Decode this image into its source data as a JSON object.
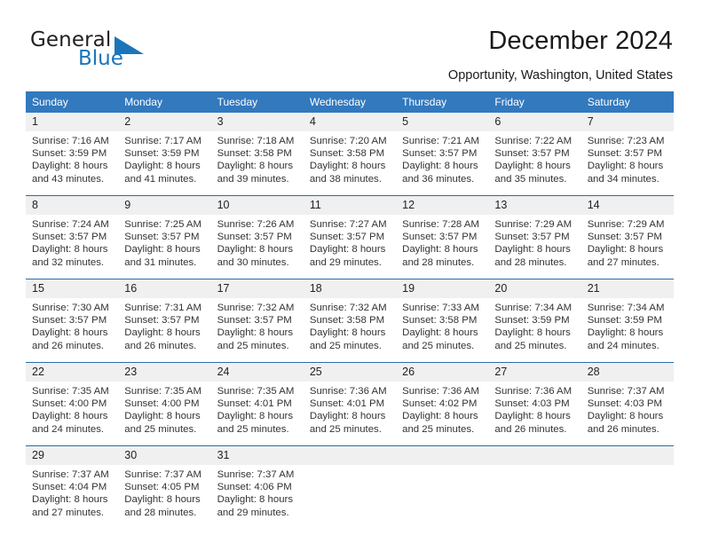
{
  "brand": {
    "word_one": "General",
    "word_two": "Blue",
    "triangle_color": "#1b75bb",
    "text_color": "#231f20"
  },
  "header": {
    "title": "December 2024",
    "location": "Opportunity, Washington, United States"
  },
  "theme": {
    "header_blue": "#3279be",
    "row_divider_blue": "#2b6ca8",
    "daynum_background": "#f0f0f0",
    "body_background": "#ffffff"
  },
  "weekdays": [
    "Sunday",
    "Monday",
    "Tuesday",
    "Wednesday",
    "Thursday",
    "Friday",
    "Saturday"
  ],
  "weeks": [
    [
      {
        "day": "1",
        "sunrise": "Sunrise: 7:16 AM",
        "sunset": "Sunset: 3:59 PM",
        "daylight_line1": "Daylight: 8 hours",
        "daylight_line2": "and 43 minutes."
      },
      {
        "day": "2",
        "sunrise": "Sunrise: 7:17 AM",
        "sunset": "Sunset: 3:59 PM",
        "daylight_line1": "Daylight: 8 hours",
        "daylight_line2": "and 41 minutes."
      },
      {
        "day": "3",
        "sunrise": "Sunrise: 7:18 AM",
        "sunset": "Sunset: 3:58 PM",
        "daylight_line1": "Daylight: 8 hours",
        "daylight_line2": "and 39 minutes."
      },
      {
        "day": "4",
        "sunrise": "Sunrise: 7:20 AM",
        "sunset": "Sunset: 3:58 PM",
        "daylight_line1": "Daylight: 8 hours",
        "daylight_line2": "and 38 minutes."
      },
      {
        "day": "5",
        "sunrise": "Sunrise: 7:21 AM",
        "sunset": "Sunset: 3:57 PM",
        "daylight_line1": "Daylight: 8 hours",
        "daylight_line2": "and 36 minutes."
      },
      {
        "day": "6",
        "sunrise": "Sunrise: 7:22 AM",
        "sunset": "Sunset: 3:57 PM",
        "daylight_line1": "Daylight: 8 hours",
        "daylight_line2": "and 35 minutes."
      },
      {
        "day": "7",
        "sunrise": "Sunrise: 7:23 AM",
        "sunset": "Sunset: 3:57 PM",
        "daylight_line1": "Daylight: 8 hours",
        "daylight_line2": "and 34 minutes."
      }
    ],
    [
      {
        "day": "8",
        "sunrise": "Sunrise: 7:24 AM",
        "sunset": "Sunset: 3:57 PM",
        "daylight_line1": "Daylight: 8 hours",
        "daylight_line2": "and 32 minutes."
      },
      {
        "day": "9",
        "sunrise": "Sunrise: 7:25 AM",
        "sunset": "Sunset: 3:57 PM",
        "daylight_line1": "Daylight: 8 hours",
        "daylight_line2": "and 31 minutes."
      },
      {
        "day": "10",
        "sunrise": "Sunrise: 7:26 AM",
        "sunset": "Sunset: 3:57 PM",
        "daylight_line1": "Daylight: 8 hours",
        "daylight_line2": "and 30 minutes."
      },
      {
        "day": "11",
        "sunrise": "Sunrise: 7:27 AM",
        "sunset": "Sunset: 3:57 PM",
        "daylight_line1": "Daylight: 8 hours",
        "daylight_line2": "and 29 minutes."
      },
      {
        "day": "12",
        "sunrise": "Sunrise: 7:28 AM",
        "sunset": "Sunset: 3:57 PM",
        "daylight_line1": "Daylight: 8 hours",
        "daylight_line2": "and 28 minutes."
      },
      {
        "day": "13",
        "sunrise": "Sunrise: 7:29 AM",
        "sunset": "Sunset: 3:57 PM",
        "daylight_line1": "Daylight: 8 hours",
        "daylight_line2": "and 28 minutes."
      },
      {
        "day": "14",
        "sunrise": "Sunrise: 7:29 AM",
        "sunset": "Sunset: 3:57 PM",
        "daylight_line1": "Daylight: 8 hours",
        "daylight_line2": "and 27 minutes."
      }
    ],
    [
      {
        "day": "15",
        "sunrise": "Sunrise: 7:30 AM",
        "sunset": "Sunset: 3:57 PM",
        "daylight_line1": "Daylight: 8 hours",
        "daylight_line2": "and 26 minutes."
      },
      {
        "day": "16",
        "sunrise": "Sunrise: 7:31 AM",
        "sunset": "Sunset: 3:57 PM",
        "daylight_line1": "Daylight: 8 hours",
        "daylight_line2": "and 26 minutes."
      },
      {
        "day": "17",
        "sunrise": "Sunrise: 7:32 AM",
        "sunset": "Sunset: 3:57 PM",
        "daylight_line1": "Daylight: 8 hours",
        "daylight_line2": "and 25 minutes."
      },
      {
        "day": "18",
        "sunrise": "Sunrise: 7:32 AM",
        "sunset": "Sunset: 3:58 PM",
        "daylight_line1": "Daylight: 8 hours",
        "daylight_line2": "and 25 minutes."
      },
      {
        "day": "19",
        "sunrise": "Sunrise: 7:33 AM",
        "sunset": "Sunset: 3:58 PM",
        "daylight_line1": "Daylight: 8 hours",
        "daylight_line2": "and 25 minutes."
      },
      {
        "day": "20",
        "sunrise": "Sunrise: 7:34 AM",
        "sunset": "Sunset: 3:59 PM",
        "daylight_line1": "Daylight: 8 hours",
        "daylight_line2": "and 25 minutes."
      },
      {
        "day": "21",
        "sunrise": "Sunrise: 7:34 AM",
        "sunset": "Sunset: 3:59 PM",
        "daylight_line1": "Daylight: 8 hours",
        "daylight_line2": "and 24 minutes."
      }
    ],
    [
      {
        "day": "22",
        "sunrise": "Sunrise: 7:35 AM",
        "sunset": "Sunset: 4:00 PM",
        "daylight_line1": "Daylight: 8 hours",
        "daylight_line2": "and 24 minutes."
      },
      {
        "day": "23",
        "sunrise": "Sunrise: 7:35 AM",
        "sunset": "Sunset: 4:00 PM",
        "daylight_line1": "Daylight: 8 hours",
        "daylight_line2": "and 25 minutes."
      },
      {
        "day": "24",
        "sunrise": "Sunrise: 7:35 AM",
        "sunset": "Sunset: 4:01 PM",
        "daylight_line1": "Daylight: 8 hours",
        "daylight_line2": "and 25 minutes."
      },
      {
        "day": "25",
        "sunrise": "Sunrise: 7:36 AM",
        "sunset": "Sunset: 4:01 PM",
        "daylight_line1": "Daylight: 8 hours",
        "daylight_line2": "and 25 minutes."
      },
      {
        "day": "26",
        "sunrise": "Sunrise: 7:36 AM",
        "sunset": "Sunset: 4:02 PM",
        "daylight_line1": "Daylight: 8 hours",
        "daylight_line2": "and 25 minutes."
      },
      {
        "day": "27",
        "sunrise": "Sunrise: 7:36 AM",
        "sunset": "Sunset: 4:03 PM",
        "daylight_line1": "Daylight: 8 hours",
        "daylight_line2": "and 26 minutes."
      },
      {
        "day": "28",
        "sunrise": "Sunrise: 7:37 AM",
        "sunset": "Sunset: 4:03 PM",
        "daylight_line1": "Daylight: 8 hours",
        "daylight_line2": "and 26 minutes."
      }
    ],
    [
      {
        "day": "29",
        "sunrise": "Sunrise: 7:37 AM",
        "sunset": "Sunset: 4:04 PM",
        "daylight_line1": "Daylight: 8 hours",
        "daylight_line2": "and 27 minutes."
      },
      {
        "day": "30",
        "sunrise": "Sunrise: 7:37 AM",
        "sunset": "Sunset: 4:05 PM",
        "daylight_line1": "Daylight: 8 hours",
        "daylight_line2": "and 28 minutes."
      },
      {
        "day": "31",
        "sunrise": "Sunrise: 7:37 AM",
        "sunset": "Sunset: 4:06 PM",
        "daylight_line1": "Daylight: 8 hours",
        "daylight_line2": "and 29 minutes."
      },
      {
        "day": "",
        "sunrise": "",
        "sunset": "",
        "daylight_line1": "",
        "daylight_line2": ""
      },
      {
        "day": "",
        "sunrise": "",
        "sunset": "",
        "daylight_line1": "",
        "daylight_line2": ""
      },
      {
        "day": "",
        "sunrise": "",
        "sunset": "",
        "daylight_line1": "",
        "daylight_line2": ""
      },
      {
        "day": "",
        "sunrise": "",
        "sunset": "",
        "daylight_line1": "",
        "daylight_line2": ""
      }
    ]
  ]
}
